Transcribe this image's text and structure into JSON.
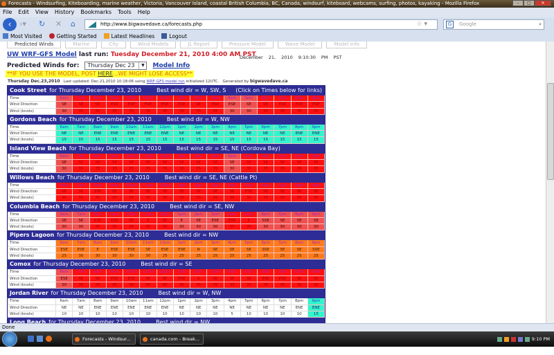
{
  "window": {
    "title": "Forecasts - Windsurfing, Kiteboarding, marine weather, Victoria, Vancouver Island, coastal British Columbia, BC, Canada, windsurf, kiteboard, webcams, surfing, photos, kayaking - Mozilla Firefox"
  },
  "menu": [
    "File",
    "Edit",
    "View",
    "History",
    "Bookmarks",
    "Tools",
    "Help"
  ],
  "url": "http://www.bigwavedave.ca/forecasts.php",
  "search_placeholder": "Google",
  "bookmarks": [
    "Most Visited",
    "Getting Started",
    "Latest Headlines",
    "Logout"
  ],
  "page": {
    "tabs": [
      "Predicted Winds",
      "Marine",
      "City",
      "Wind Models",
      "JL Report",
      "Pressure Model",
      "Wave Model",
      "Model Info"
    ],
    "model_link": "UW WRF-GFS Model",
    "last_run_label": "last run:",
    "last_run": "Tuesday December 21, 2010 4:00 AM PST",
    "current_time": "December 21, 2010 9:10:30 PM PST",
    "predicted_label": "Predicted Winds for:",
    "predicted_day": "Thursday Dec 23",
    "model_info": "Model Info",
    "warning_pre": "**IF YOU USE THE MODEL, POST ",
    "warning_link": "HERE",
    "warning_post": "...WE MIGHT LOSE ACCESS**",
    "sub_date": "Thursday Dec.23,2010",
    "sub_updated": "Last updated: Dec.21,2010 10:18:06 using",
    "sub_link": "WRF-GFS model run",
    "sub_init": "initialized 12UTC.",
    "sub_gen": "Generated by",
    "sub_site": "bigwavedave.ca",
    "row_labels": [
      "Time",
      "Wind Direction",
      "Wind (knots)"
    ],
    "times": [
      "6am",
      "7am",
      "8am",
      "9am",
      "10am",
      "11am",
      "12pm",
      "1pm",
      "2pm",
      "3pm",
      "4pm",
      "5pm",
      "6pm",
      "7pm",
      "8pm",
      "9pm"
    ],
    "date_text": "for Thursday December 23, 2010",
    "click_note": "(Click on Times below for links)",
    "locations": [
      {
        "name": "Cook Street",
        "best": "Best wind dir = W, SW, S",
        "dirs": [
          "SE",
          "SE",
          "SE",
          "ESE",
          "ESE",
          "ESE",
          "ESE",
          "ESE",
          "SE",
          "ESE",
          "ESE",
          "SE",
          "SE",
          "ESE",
          "ESE",
          "ESE"
        ],
        "winds": [
          30,
          35,
          35,
          35,
          35,
          35,
          35,
          35,
          35,
          35,
          30,
          30,
          35,
          35,
          35,
          35
        ],
        "levels": [
          "moderate",
          "strong",
          "strong",
          "strong",
          "strong",
          "strong",
          "strong",
          "strong",
          "strong",
          "strong",
          "moderate",
          "moderate",
          "strong",
          "strong",
          "strong",
          "strong"
        ]
      },
      {
        "name": "Gordons Beach",
        "best": "Best wind dir = W, NW",
        "dirs": [
          "NE",
          "NE",
          "ENE",
          "ENE",
          "ENE",
          "ENE",
          "ENE",
          "NE",
          "NE",
          "NE",
          "NE",
          "NE",
          "NE",
          "NE",
          "ENE",
          "ENE"
        ],
        "winds": [
          15,
          15,
          15,
          15,
          15,
          15,
          15,
          15,
          15,
          15,
          15,
          15,
          15,
          15,
          15,
          15
        ],
        "levels": [
          "light",
          "light",
          "light",
          "light",
          "light",
          "light",
          "light",
          "light",
          "light",
          "light",
          "light",
          "light",
          "light",
          "light",
          "light",
          "light"
        ]
      },
      {
        "name": "Island View Beach",
        "best": "Best wind dir = SE, NE (Cordova Bay)",
        "dirs": [
          "SE",
          "SE",
          "SE",
          "SE",
          "SE",
          "SE",
          "SE",
          "SE",
          "SE",
          "SE",
          "SE",
          "SE",
          "SE",
          "SE",
          "SE",
          "SE"
        ],
        "winds": [
          30,
          35,
          35,
          35,
          35,
          35,
          35,
          35,
          35,
          35,
          30,
          35,
          35,
          35,
          35,
          35
        ],
        "levels": [
          "moderate",
          "strong",
          "strong",
          "strong",
          "strong",
          "strong",
          "strong",
          "strong",
          "strong",
          "strong",
          "moderate",
          "strong",
          "strong",
          "strong",
          "strong",
          "strong"
        ]
      },
      {
        "name": "Willows Beach",
        "best": "Best wind dir = SE, NE (Cattle Pt)",
        "dirs": [
          "SE",
          "SE",
          "SSE",
          "SE",
          "SE",
          "SE",
          "SE",
          "SE",
          "SE",
          "SE",
          "SE",
          "ESE",
          "SE",
          "SE",
          "SE",
          "SE"
        ],
        "winds": [
          35,
          35,
          35,
          35,
          35,
          35,
          35,
          35,
          35,
          35,
          35,
          35,
          35,
          35,
          35,
          35
        ],
        "levels": [
          "strong",
          "strong",
          "strong",
          "strong",
          "strong",
          "strong",
          "strong",
          "strong",
          "strong",
          "strong",
          "strong",
          "strong",
          "strong",
          "strong",
          "strong",
          "strong"
        ]
      },
      {
        "name": "Columbia Beach",
        "best": "Best wind dir = SE, NW",
        "dirs": [
          "SE",
          "SE",
          "ESE",
          "ESE",
          "SE",
          "E",
          "SE",
          "E",
          "SE",
          "ESE",
          "ESE",
          "E",
          "SSE",
          "SE",
          "SE",
          "SE"
        ],
        "winds": [
          30,
          30,
          35,
          35,
          35,
          35,
          35,
          30,
          30,
          30,
          35,
          35,
          30,
          30,
          30,
          30
        ],
        "levels": [
          "moderate",
          "moderate",
          "strong",
          "strong",
          "strong",
          "strong",
          "strong",
          "moderate",
          "moderate",
          "moderate",
          "strong",
          "strong",
          "moderate",
          "moderate",
          "moderate",
          "moderate"
        ]
      },
      {
        "name": "Pipers Lagoon",
        "best": "Best wind dir = NW",
        "dirs": [
          "ESE",
          "ESE",
          "E",
          "ESE",
          "ESE",
          "SE",
          "ESE",
          "ESE",
          "N",
          "SE",
          "SE",
          "SE",
          "SSE",
          "SE",
          "SE",
          "SSE"
        ],
        "winds": [
          25,
          30,
          30,
          30,
          30,
          30,
          25,
          25,
          25,
          25,
          25,
          25,
          25,
          25,
          25,
          25
        ],
        "levels": [
          "orange",
          "orange",
          "orange",
          "orange",
          "orange",
          "orange",
          "orange",
          "orange",
          "orange",
          "orange",
          "orange",
          "orange",
          "orange",
          "orange",
          "orange",
          "orange"
        ]
      },
      {
        "name": "Comox",
        "best": "Best wind dir = SE",
        "dirs": [
          "ESE",
          "SE",
          "SE",
          "ESE",
          "ESE",
          "SE",
          "SE",
          "ESE",
          "S",
          "SE",
          "SE",
          "SE",
          "ESE",
          "ESE",
          "SE",
          "SE"
        ],
        "winds": [
          30,
          35,
          35,
          35,
          40,
          40,
          40,
          35,
          35,
          35,
          35,
          35,
          35,
          35,
          35,
          35
        ],
        "levels": [
          "moderate",
          "strong",
          "strong",
          "strong",
          "strong",
          "strong",
          "strong",
          "strong",
          "strong",
          "strong",
          "strong",
          "strong",
          "strong",
          "strong",
          "strong",
          "strong"
        ]
      },
      {
        "name": "Jordan River",
        "best": "Best wind dir = W, NW",
        "dirs": [
          "NE",
          "NE",
          "ENE",
          "ENE",
          "ENE",
          "ENE",
          "ENE",
          "NE",
          "NE",
          "NE",
          "NE",
          "NE",
          "NE",
          "NE",
          "ENE",
          "ENE"
        ],
        "winds": [
          10,
          10,
          10,
          10,
          10,
          10,
          10,
          10,
          10,
          10,
          5,
          10,
          10,
          10,
          10,
          15
        ],
        "levels": [
          "none",
          "none",
          "none",
          "none",
          "none",
          "none",
          "none",
          "none",
          "none",
          "none",
          "none",
          "none",
          "none",
          "none",
          "none",
          "light"
        ]
      },
      {
        "name": "Long Beach",
        "best": "Best wind dir = NW"
      }
    ]
  },
  "status": "Done",
  "taskbar": {
    "tasks": [
      "Forecasts - Windsur...",
      "canada.com - Break..."
    ],
    "clock": "9:10 PM"
  }
}
